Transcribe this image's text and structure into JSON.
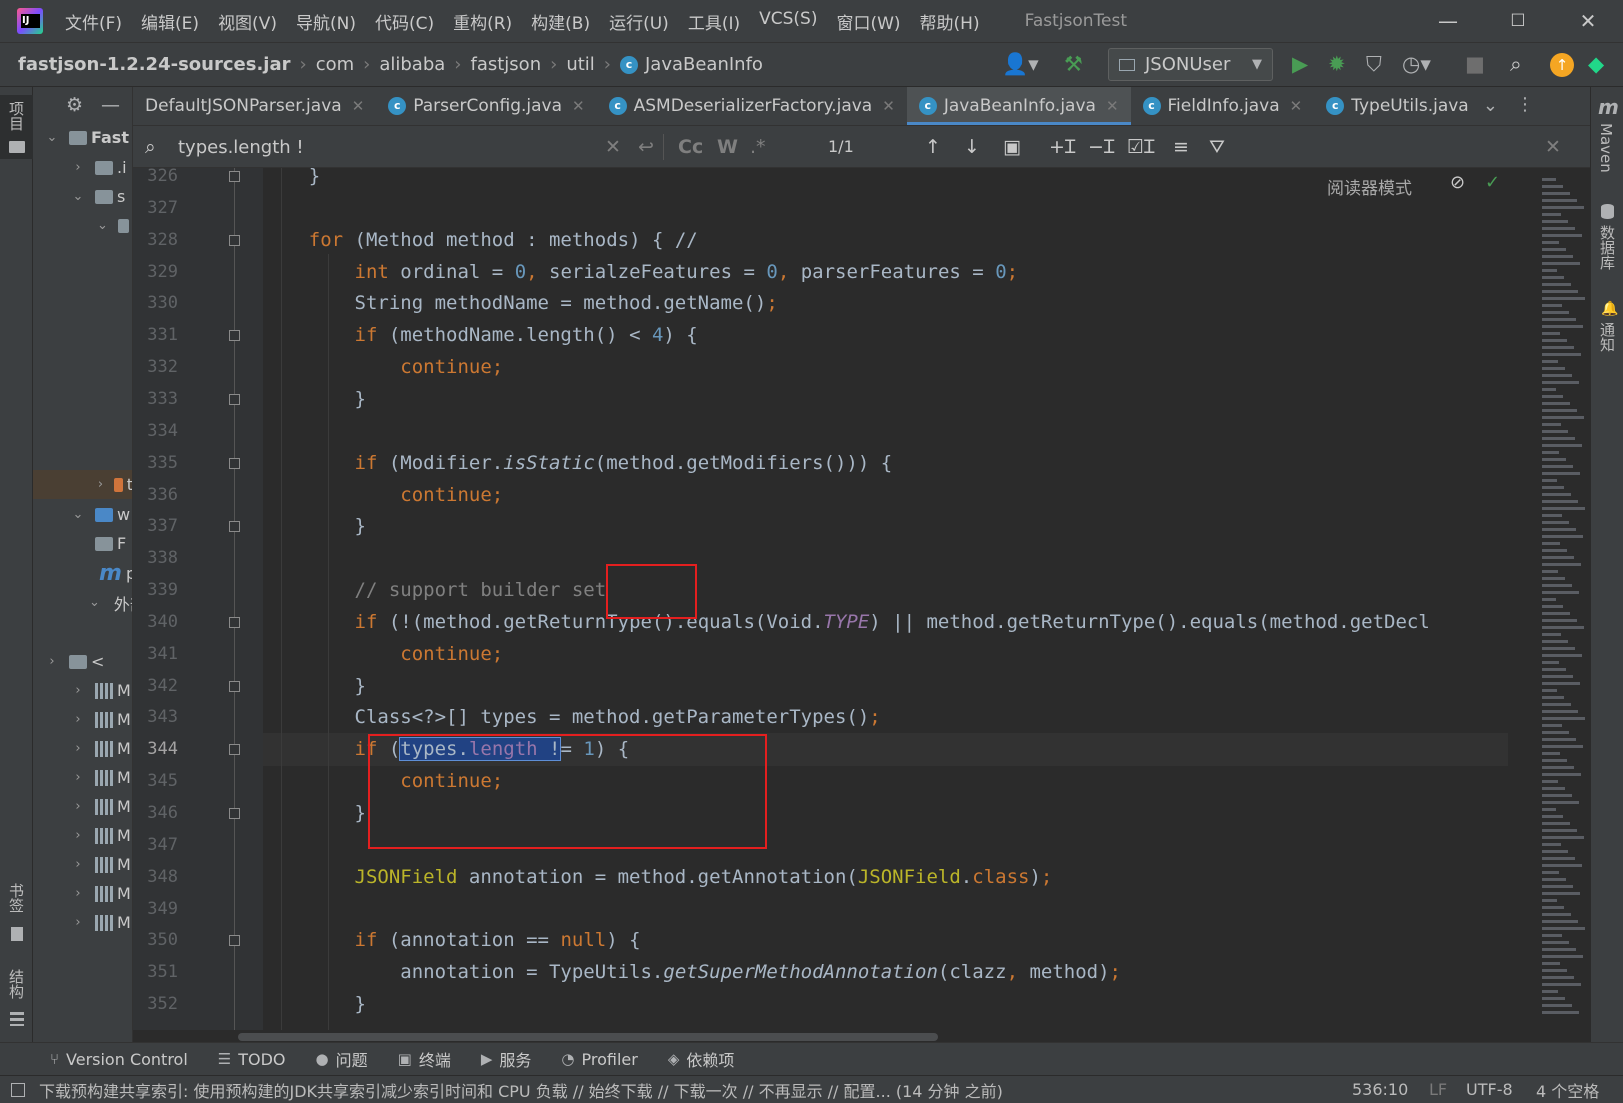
{
  "menu": {
    "items": [
      "文件(F)",
      "编辑(E)",
      "视图(V)",
      "导航(N)",
      "代码(C)",
      "重构(R)",
      "构建(B)",
      "运行(U)",
      "工具(I)",
      "VCS(S)",
      "窗口(W)",
      "帮助(H)"
    ],
    "window_title": "FastjsonTest",
    "minimize": "—",
    "maximize": "☐",
    "close": "✕"
  },
  "breadcrumb": {
    "items": [
      "fastjson-1.2.24-sources.jar",
      "com",
      "alibaba",
      "fastjson",
      "util",
      "JavaBeanInfo"
    ]
  },
  "toolbar": {
    "run_config": "JSONUser"
  },
  "left_strip": {
    "project": "项目",
    "bookmarks": "书签",
    "structure": "结构"
  },
  "right_strip": {
    "maven": "Maven",
    "database": "数据库",
    "notifications": "通知"
  },
  "project": {
    "root": "Fast",
    "rows": [
      {
        "label": "Fast",
        "chev": "⌄"
      },
      {
        "label": ".i",
        "chev": "›"
      },
      {
        "label": "s",
        "chev": "⌄"
      },
      {
        "label": "",
        "chev": "⌄"
      },
      {
        "label": "t",
        "chev": "›"
      },
      {
        "label": "w",
        "chev": "⌄"
      },
      {
        "label": "F",
        "chev": ""
      },
      {
        "label": "p",
        "chev": ""
      },
      {
        "label": "外部",
        "chev": "⌄"
      },
      {
        "label": "<",
        "chev": "›"
      },
      {
        "label": "M",
        "chev": "›"
      },
      {
        "label": "M",
        "chev": "›"
      },
      {
        "label": "M",
        "chev": "›"
      },
      {
        "label": "M",
        "chev": "›"
      },
      {
        "label": "M",
        "chev": "›"
      },
      {
        "label": "M",
        "chev": "›"
      },
      {
        "label": "M",
        "chev": "›"
      },
      {
        "label": "M",
        "chev": "›"
      },
      {
        "label": "M",
        "chev": "›"
      }
    ]
  },
  "tabs": [
    {
      "label": "DefaultJSONParser.java",
      "icon": false,
      "active": false
    },
    {
      "label": "ParserConfig.java",
      "icon": true,
      "active": false
    },
    {
      "label": "ASMDeserializerFactory.java",
      "icon": true,
      "active": false
    },
    {
      "label": "JavaBeanInfo.java",
      "icon": true,
      "active": true
    },
    {
      "label": "FieldInfo.java",
      "icon": true,
      "active": false
    },
    {
      "label": "TypeUtils.java",
      "icon": true,
      "active": false
    }
  ],
  "search": {
    "value": "types.length !",
    "match_case": "Cc",
    "words": "W",
    "regex": ".*",
    "count": "1/1"
  },
  "editor": {
    "reader_mode": "阅读器模式",
    "lines": [
      {
        "n": "326",
        "html": "    }"
      },
      {
        "n": "327",
        "html": ""
      },
      {
        "n": "328",
        "html": "    <span class=\"kw\">for</span> (Method method : methods) { //"
      },
      {
        "n": "329",
        "html": "        <span class=\"kw\">int</span> ordinal = <span class=\"num\">0</span><span class=\"kw\">,</span> serialzeFeatures = <span class=\"num\">0</span><span class=\"kw\">,</span> parserFeatures = <span class=\"num\">0</span><span class=\"kw\">;</span>"
      },
      {
        "n": "330",
        "html": "        String methodName = method.getName()<span class=\"kw\">;</span>"
      },
      {
        "n": "331",
        "html": "        <span class=\"kw\">if</span> (methodName.length() &lt; <span class=\"num\">4</span>) {"
      },
      {
        "n": "332",
        "html": "            <span class=\"kw\">continue;</span>"
      },
      {
        "n": "333",
        "html": "        }"
      },
      {
        "n": "334",
        "html": ""
      },
      {
        "n": "335",
        "html": "        <span class=\"kw\">if</span> (Modifier.<span class=\"fn\">isStatic</span>(method.getModifiers())) {"
      },
      {
        "n": "336",
        "html": "            <span class=\"kw\">continue;</span>"
      },
      {
        "n": "337",
        "html": "        }"
      },
      {
        "n": "338",
        "html": ""
      },
      {
        "n": "339",
        "html": "        <span class=\"cm\">// support builder set</span>"
      },
      {
        "n": "340",
        "html": "        <span class=\"kw\">if</span> (!(method.getReturnType().equals(Void.<span class=\"st\">TYPE</span>) || method.getReturnType().equals(method.getDecl"
      },
      {
        "n": "341",
        "html": "            <span class=\"kw\">continue;</span>"
      },
      {
        "n": "342",
        "html": "        }"
      },
      {
        "n": "343",
        "html": "        Class&lt;?&gt;[] types = method.getParameterTypes()<span class=\"kw\">;</span>"
      },
      {
        "n": "344",
        "html": "        <span class=\"kw\">if</span> (<span class=\"sel\">types.<span class=\"st\" style=\"font-style:normal\">length</span> !</span>= <span class=\"num\">1</span>) {"
      },
      {
        "n": "345",
        "html": "            <span class=\"kw\">continue;</span>"
      },
      {
        "n": "346",
        "html": "        }"
      },
      {
        "n": "347",
        "html": ""
      },
      {
        "n": "348",
        "html": "        <span class=\"ann\">JSONField</span> annotation = method.getAnnotation(<span class=\"ann\">JSONField</span>.<span class=\"kw\">class</span>)<span class=\"kw\">;</span>"
      },
      {
        "n": "349",
        "html": ""
      },
      {
        "n": "350",
        "html": "        <span class=\"kw\">if</span> (annotation == <span class=\"kw\">null</span>) {"
      },
      {
        "n": "351",
        "html": "            annotation = TypeUtils.<span class=\"fn\">getSuperMethodAnnotation</span>(clazz<span class=\"kw\">,</span> method)<span class=\"kw\">;</span>"
      },
      {
        "n": "352",
        "html": "        }"
      }
    ]
  },
  "bottom_tabs": [
    {
      "icon": "⑂",
      "label": "Version Control"
    },
    {
      "icon": "☰",
      "label": "TODO"
    },
    {
      "icon": "●",
      "label": "问题"
    },
    {
      "icon": "▣",
      "label": "终端"
    },
    {
      "icon": "▶",
      "label": "服务"
    },
    {
      "icon": "◔",
      "label": "Profiler"
    },
    {
      "icon": "◈",
      "label": "依赖项"
    }
  ],
  "status": {
    "message": "下载预构建共享索引: 使用预构建的JDK共享索引减少索引时间和 CPU 负载 // 始终下载 // 下载一次 // 不再显示 // 配置... (14 分钟 之前)",
    "position": "536:10",
    "line_sep": "LF",
    "encoding": "UTF-8",
    "indent": "4 个空格"
  },
  "colors": {
    "accent": "#4a88c7",
    "highlight_box": "#e41f1f",
    "selection": "#214283"
  }
}
